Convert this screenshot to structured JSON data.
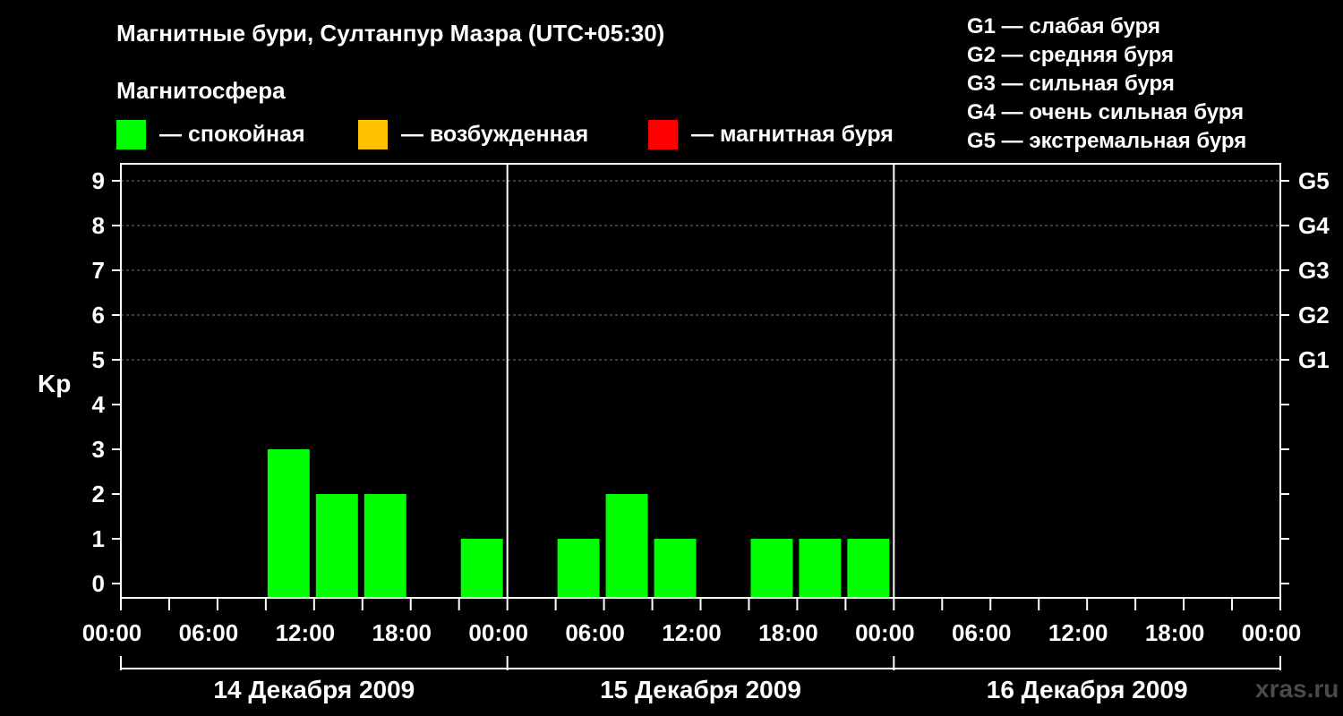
{
  "title": "Магнитные бури, Султанпур Мазра (UTC+05:30)",
  "magnetosphere_label": "Магнитосфера",
  "legend": [
    {
      "label": "— спокойная",
      "color": "#00ff00"
    },
    {
      "label": "— возбужденная",
      "color": "#ffc000"
    },
    {
      "label": "— магнитная буря",
      "color": "#ff0000"
    }
  ],
  "g_scale": [
    "G1 — слабая буря",
    "G2 — средняя буря",
    "G3 — сильная буря",
    "G4 — очень сильная буря",
    "G5 — экстремальная буря"
  ],
  "watermark": "xras.ru",
  "chart_data": {
    "type": "bar",
    "ylabel": "Kp",
    "ylim": [
      0,
      9
    ],
    "yticks": [
      "0",
      "1",
      "2",
      "3",
      "4",
      "5",
      "6",
      "7",
      "8",
      "9"
    ],
    "right_ticks": [
      {
        "kp": 5,
        "label": "G1"
      },
      {
        "kp": 6,
        "label": "G2"
      },
      {
        "kp": 7,
        "label": "G3"
      },
      {
        "kp": 8,
        "label": "G4"
      },
      {
        "kp": 9,
        "label": "G5"
      }
    ],
    "grid": "dashed horizontal at Kp 5-9",
    "xtick_labels": [
      "00:00",
      "06:00",
      "12:00",
      "18:00",
      "00:00",
      "06:00",
      "12:00",
      "18:00",
      "00:00",
      "06:00",
      "12:00",
      "18:00",
      "00:00"
    ],
    "days": [
      "14 Декабря 2009",
      "15 Декабря 2009",
      "16 Декабря 2009"
    ],
    "interval_hours": 3,
    "values": [
      null,
      null,
      null,
      3,
      2,
      2,
      null,
      1,
      null,
      1,
      2,
      1,
      null,
      1,
      1,
      1,
      null,
      null,
      null,
      null,
      null,
      null,
      null,
      null
    ],
    "colors": {
      "quiet": "#00ff00",
      "active": "#ffc000",
      "storm": "#ff0000"
    }
  }
}
